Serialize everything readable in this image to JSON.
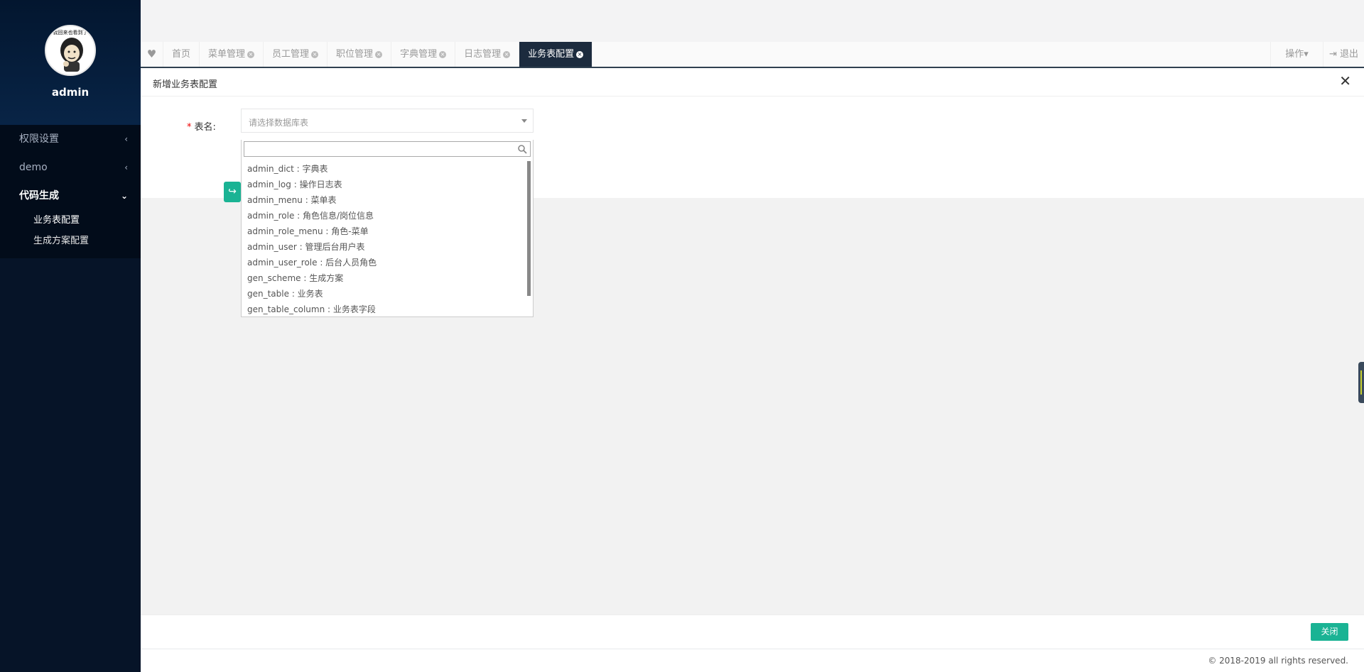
{
  "sidebar": {
    "avatar_caption": "我回来也看到了",
    "user_name": "admin",
    "menu": [
      {
        "label": "权限设置",
        "arrow": "‹"
      },
      {
        "label": "demo",
        "arrow": "‹"
      },
      {
        "label": "代码生成",
        "arrow": "⌄"
      }
    ],
    "submenu": [
      {
        "label": "业务表配置"
      },
      {
        "label": "生成方案配置"
      }
    ]
  },
  "tabs": {
    "heart": "♥",
    "items": [
      {
        "label": "首页"
      },
      {
        "label": "菜单管理"
      },
      {
        "label": "员工管理"
      },
      {
        "label": "职位管理"
      },
      {
        "label": "字典管理"
      },
      {
        "label": "日志管理"
      },
      {
        "label": "业务表配置"
      }
    ],
    "close_glyph": "×",
    "ops_label": "操作▾",
    "logout_label": "⇥ 退出"
  },
  "modal": {
    "title": "新增业务表配置",
    "close_glyph": "✕",
    "field_label": "表名:",
    "required_mark": "*",
    "select_placeholder": "请选择数据库表",
    "options": [
      "admin_dict : 字典表",
      "admin_log : 操作日志表",
      "admin_menu : 菜单表",
      "admin_role : 角色信息/岗位信息",
      "admin_role_menu : 角色-菜单",
      "admin_user : 管理后台用户表",
      "admin_user_role : 后台人员角色",
      "gen_scheme : 生成方案",
      "gen_table : 业务表",
      "gen_table_column : 业务表字段"
    ],
    "close_button": "关闭"
  },
  "footer": {
    "copyright": "© 2018-2019 all rights reserved."
  }
}
